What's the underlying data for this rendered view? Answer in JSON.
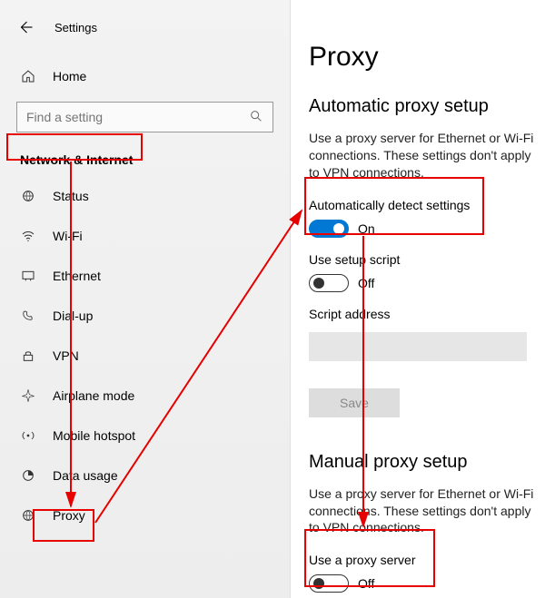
{
  "titlebar": {
    "title": "Settings"
  },
  "home": {
    "label": "Home"
  },
  "search": {
    "placeholder": "Find a setting"
  },
  "section": {
    "heading": "Network & Internet"
  },
  "nav": [
    {
      "label": "Status"
    },
    {
      "label": "Wi-Fi"
    },
    {
      "label": "Ethernet"
    },
    {
      "label": "Dial-up"
    },
    {
      "label": "VPN"
    },
    {
      "label": "Airplane mode"
    },
    {
      "label": "Mobile hotspot"
    },
    {
      "label": "Data usage"
    },
    {
      "label": "Proxy"
    }
  ],
  "main": {
    "title": "Proxy",
    "auto_heading": "Automatic proxy setup",
    "auto_desc": "Use a proxy server for Ethernet or Wi-Fi connections. These settings don't apply to VPN connections.",
    "auto_detect": {
      "label": "Automatically detect settings",
      "state_on": "On"
    },
    "setup_script": {
      "label": "Use setup script",
      "state_off": "Off"
    },
    "script_address_label": "Script address",
    "save_label": "Save",
    "manual_heading": "Manual proxy setup",
    "manual_desc": "Use a proxy server for Ethernet or Wi-Fi connections. These settings don't apply to VPN connections.",
    "use_proxy": {
      "label": "Use a proxy server",
      "state_off": "Off"
    }
  }
}
